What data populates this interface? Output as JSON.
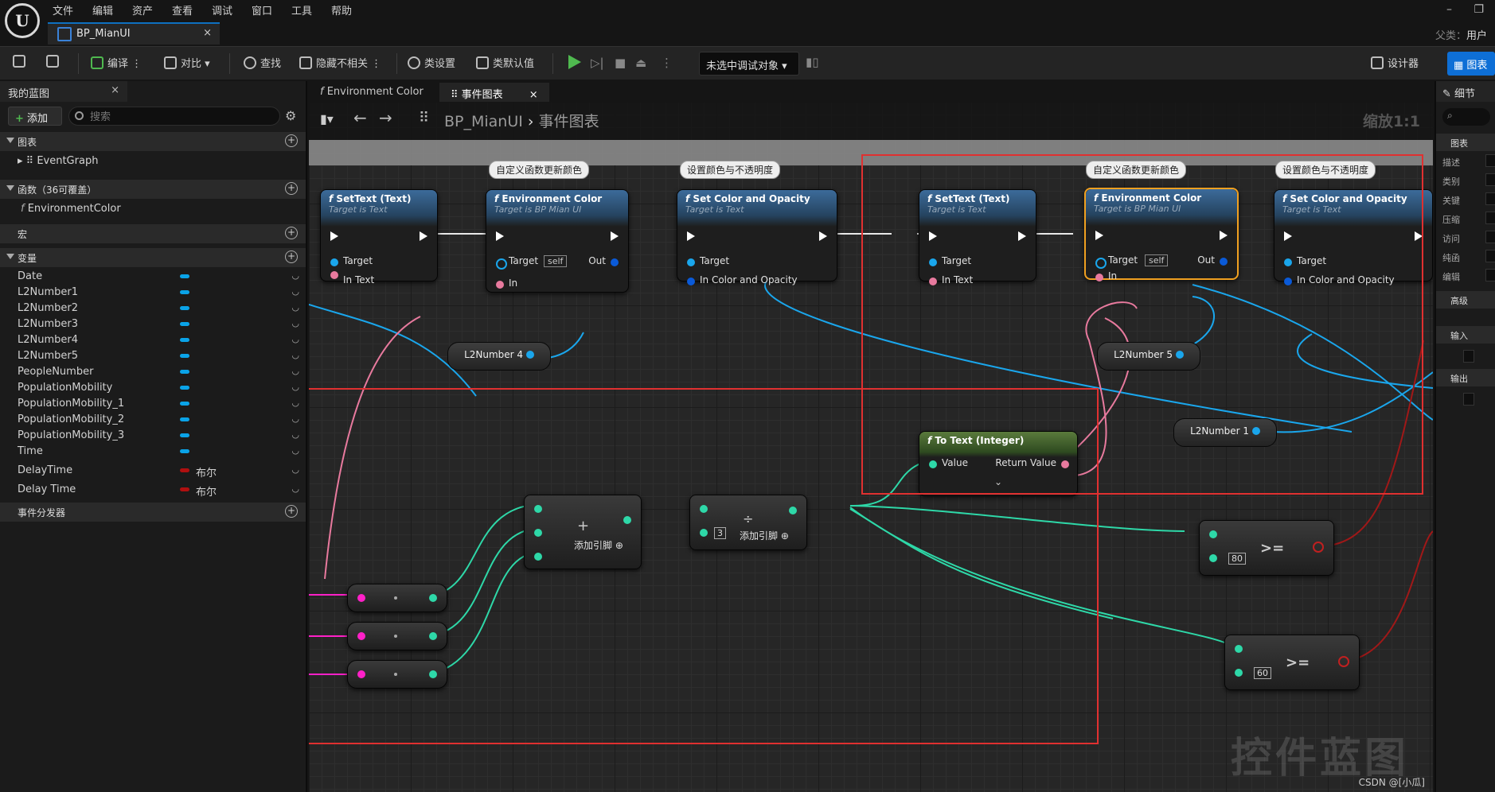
{
  "menu": [
    "文件",
    "编辑",
    "资产",
    "查看",
    "调试",
    "窗口",
    "工具",
    "帮助"
  ],
  "window": {
    "min": "–",
    "restore": "❐",
    "parent_label": "父类：",
    "parent_value": "用户"
  },
  "asset_tab": {
    "label": "BP_MianUI",
    "close": "×"
  },
  "toolbar": {
    "compile": "编译",
    "diff": "对比",
    "find": "查找",
    "hide_unrelated": "隐藏不相关",
    "class_settings": "类设置",
    "class_defaults": "类默认值",
    "debug_target": "未选中调试对象",
    "designer": "设计器",
    "graph": "图表"
  },
  "left_panel": {
    "title": "我的蓝图",
    "add": "添加",
    "search_placeholder": "搜索",
    "sections": {
      "graphs": "图表",
      "event_graph": "EventGraph",
      "functions": "函数（36可覆盖）",
      "function_item": "EnvironmentColor",
      "macros": "宏",
      "variables": "变量",
      "dispatchers": "事件分发器"
    },
    "variables": [
      {
        "name": "Date",
        "type": ""
      },
      {
        "name": "L2Number1",
        "type": ""
      },
      {
        "name": "L2Number2",
        "type": ""
      },
      {
        "name": "L2Number3",
        "type": ""
      },
      {
        "name": "L2Number4",
        "type": ""
      },
      {
        "name": "L2Number5",
        "type": ""
      },
      {
        "name": "PeopleNumber",
        "type": ""
      },
      {
        "name": "PopulationMobility",
        "type": ""
      },
      {
        "name": "PopulationMobility_1",
        "type": ""
      },
      {
        "name": "PopulationMobility_2",
        "type": ""
      },
      {
        "name": "PopulationMobility_3",
        "type": ""
      },
      {
        "name": "Time",
        "type": ""
      },
      {
        "name": "DelayTime",
        "type": "布尔"
      },
      {
        "name": "Delay Time",
        "type": "布尔"
      }
    ]
  },
  "graph_tabs": {
    "tab1": "Environment Color",
    "tab2": "事件图表",
    "close": "×"
  },
  "graph": {
    "breadcrumb_root": "BP_MianUI",
    "breadcrumb_sep": "›",
    "breadcrumb_current": "事件图表",
    "zoom": "缩放1:1",
    "comments": {
      "custom_fn": "自定义函数更新颜色",
      "set_color": "设置颜色与不透明度"
    },
    "nodes": {
      "settext_title": "SetText (Text)",
      "settext_sub": "Target is Text",
      "env_title": "Environment Color",
      "env_sub": "Target is BP Mian UI",
      "setcolor_title": "Set Color and Opacity",
      "setcolor_sub": "Target is Text",
      "pin_target": "Target",
      "pin_intext": "In Text",
      "pin_in": "In",
      "pin_out": "Out",
      "pin_self": "self",
      "pin_color": "In Color and Opacity",
      "totext_title": "To Text (Integer)",
      "pin_value": "Value",
      "pin_return": "Return Value",
      "add_pin": "添加引脚",
      "divisor": "3",
      "ge": ">=",
      "ge_val1": "80",
      "ge_val2": "60"
    },
    "vars": {
      "l2n4": "L2Number 4",
      "l2n5": "L2Number 5",
      "l2n1": "L2Number 1"
    },
    "watermark": "控件蓝图",
    "credit": "CSDN @[小瓜]"
  },
  "right_panel": {
    "title": "细节",
    "sections": {
      "graph": "图表",
      "advanced": "高级",
      "inputs": "输入",
      "outputs": "输出"
    },
    "rows": [
      "描述",
      "类别",
      "关键",
      "压缩",
      "访问",
      "纯函",
      "编辑"
    ]
  }
}
